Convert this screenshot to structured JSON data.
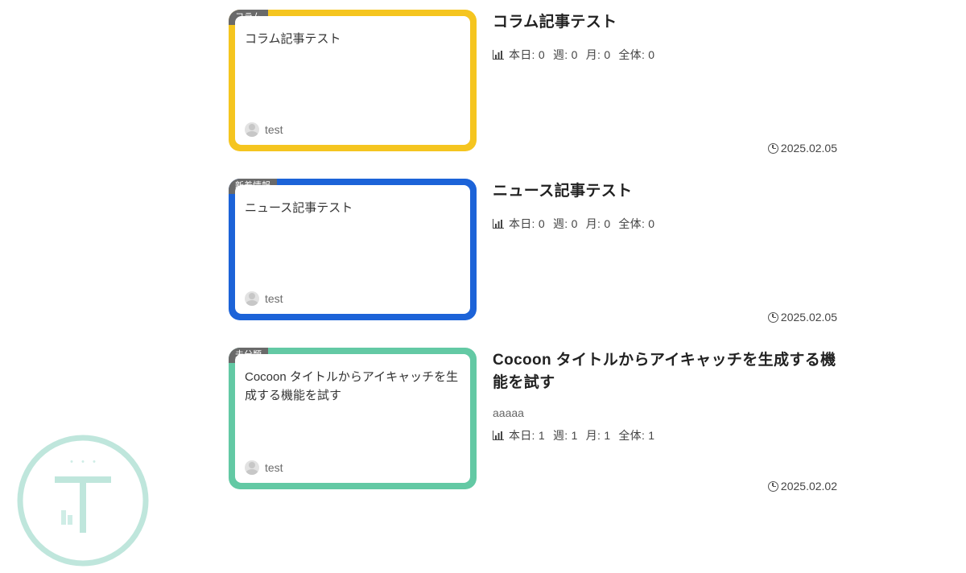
{
  "labels": {
    "today": "本日:",
    "week": "週:",
    "month": "月:",
    "total": "全体:"
  },
  "entries": [
    {
      "category": "コラム",
      "border_color": "#F5C51F",
      "thumb_title": "コラム記事テスト",
      "author": "test",
      "title": "コラム記事テスト",
      "excerpt": "",
      "stats": {
        "today": "0",
        "week": "0",
        "month": "0",
        "total": "0"
      },
      "date": "2025.02.05"
    },
    {
      "category": "新着情報",
      "border_color": "#1C63D8",
      "thumb_title": "ニュース記事テスト",
      "author": "test",
      "title": "ニュース記事テスト",
      "excerpt": "",
      "stats": {
        "today": "0",
        "week": "0",
        "month": "0",
        "total": "0"
      },
      "date": "2025.02.05"
    },
    {
      "category": "未分類",
      "border_color": "#63C9A4",
      "thumb_title": "Cocoon タイトルからアイキャッチを生成する機能を試す",
      "author": "test",
      "title": "Cocoon タイトルからアイキャッチを生成する機能を試す",
      "excerpt": "aaaaa",
      "stats": {
        "today": "1",
        "week": "1",
        "month": "1",
        "total": "1"
      },
      "date": "2025.02.02"
    }
  ]
}
